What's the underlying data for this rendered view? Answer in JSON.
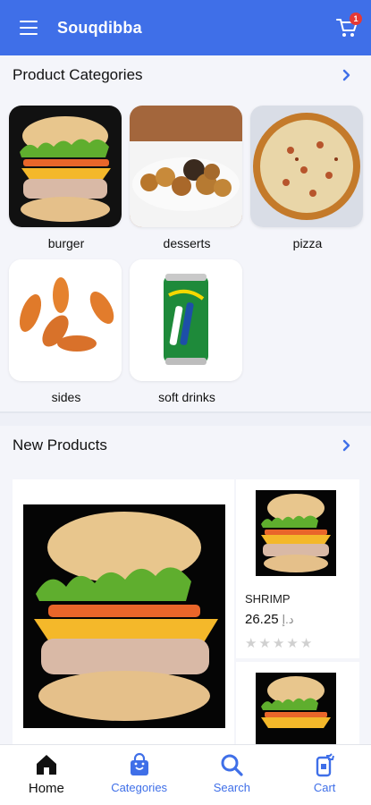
{
  "appbar": {
    "title": "Souqdibba",
    "cart_count": "1",
    "color": "#3f6fe8"
  },
  "categories_section": {
    "title": "Product Categories",
    "items": [
      {
        "label": "burger",
        "icon": "burger-image"
      },
      {
        "label": "desserts",
        "icon": "desserts-image"
      },
      {
        "label": "pizza",
        "icon": "pizza-image"
      },
      {
        "label": "sides",
        "icon": "chicken-wings-image"
      },
      {
        "label": "soft drinks",
        "icon": "soda-can-image"
      }
    ]
  },
  "new_products_section": {
    "title": "New Products",
    "items": [
      {
        "name": "SHRIMP",
        "price": "26.25",
        "currency": "د.إ",
        "rating": 0
      }
    ]
  },
  "bottom_nav": {
    "items": [
      {
        "label": "Home",
        "icon": "home-icon",
        "active": true
      },
      {
        "label": "Categories",
        "icon": "bag-icon",
        "active": false
      },
      {
        "label": "Search",
        "icon": "search-icon",
        "active": false
      },
      {
        "label": "Cart",
        "icon": "cart-icon",
        "active": false
      }
    ]
  }
}
